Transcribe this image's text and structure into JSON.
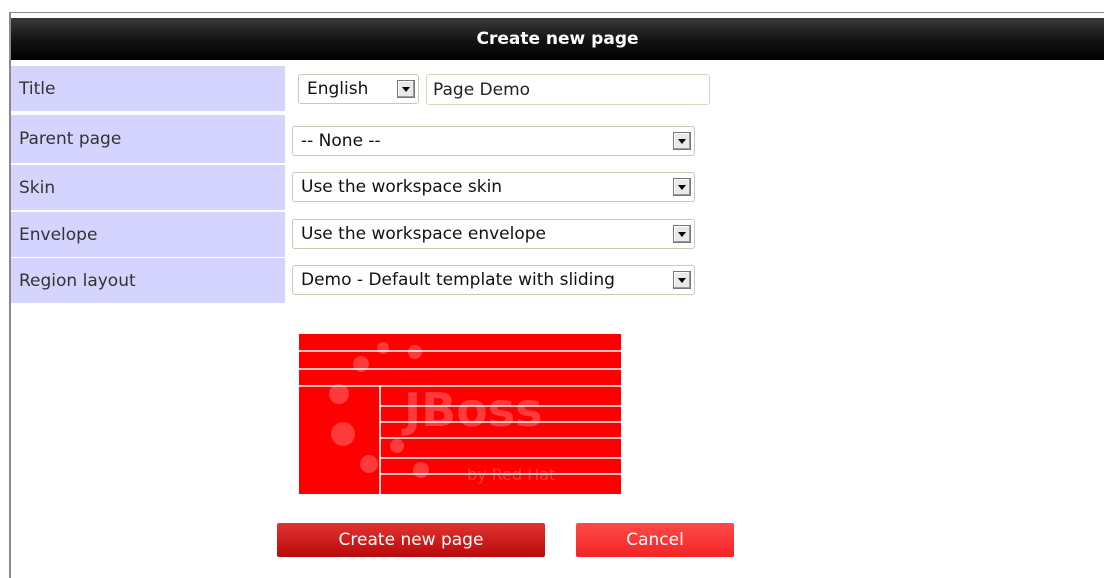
{
  "dialog": {
    "title": "Create new page"
  },
  "form": {
    "title_label": "Title",
    "language_value": "English",
    "title_value": "Page Demo",
    "parent_label": "Parent page",
    "parent_value": "-- None --",
    "skin_label": "Skin",
    "skin_value": "Use the workspace skin",
    "envelope_label": "Envelope",
    "envelope_value": "Use the workspace envelope",
    "region_label": "Region layout",
    "region_value": "Demo - Default template with sliding"
  },
  "preview": {
    "watermark_main": "JBoss",
    "watermark_sub": "by Red Hat",
    "color": "#ff0000"
  },
  "buttons": {
    "create_label": "Create new page",
    "cancel_label": "Cancel"
  },
  "colors": {
    "header_bg": "#000000",
    "label_bg": "#d4d4ff",
    "accent_red": "#e02020"
  }
}
